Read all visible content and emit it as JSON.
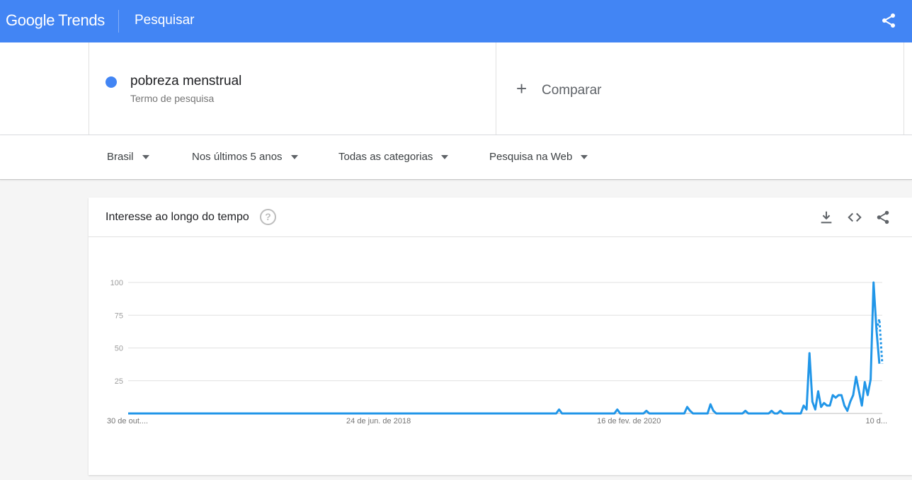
{
  "header": {
    "logo_google": "Google",
    "logo_trends": "Trends",
    "title": "Pesquisar",
    "share_icon": "share-icon"
  },
  "term": {
    "name": "pobreza menstrual",
    "subtitle": "Termo de pesquisa",
    "color": "#4285f4"
  },
  "compare": {
    "plus": "+",
    "label": "Comparar"
  },
  "filters": [
    {
      "label": "Brasil"
    },
    {
      "label": "Nos últimos 5 anos"
    },
    {
      "label": "Todas as categorias"
    },
    {
      "label": "Pesquisa na Web"
    }
  ],
  "card": {
    "title": "Interesse ao longo do tempo",
    "help": "?",
    "icons": [
      "download-icon",
      "embed-icon",
      "share-icon"
    ]
  },
  "chart_data": {
    "type": "line",
    "ylim": [
      0,
      100
    ],
    "yticks": [
      25,
      50,
      75,
      100
    ],
    "xtick_labels": [
      {
        "label": "30 de out....",
        "index": 0
      },
      {
        "label": "24 de jun. de 2018",
        "index": 86
      },
      {
        "label": "16 de fev. de 2020",
        "index": 172
      },
      {
        "label": "10 d...",
        "index": 257
      }
    ],
    "series_color": "#2196e8",
    "values": [
      0,
      0,
      0,
      0,
      0,
      0,
      0,
      0,
      0,
      0,
      0,
      0,
      0,
      0,
      0,
      0,
      0,
      0,
      0,
      0,
      0,
      0,
      0,
      0,
      0,
      0,
      0,
      0,
      0,
      0,
      0,
      0,
      0,
      0,
      0,
      0,
      0,
      0,
      0,
      0,
      0,
      0,
      0,
      0,
      0,
      0,
      0,
      0,
      0,
      0,
      0,
      0,
      0,
      0,
      0,
      0,
      0,
      0,
      0,
      0,
      0,
      0,
      0,
      0,
      0,
      0,
      0,
      0,
      0,
      0,
      0,
      0,
      0,
      0,
      0,
      0,
      0,
      0,
      0,
      0,
      0,
      0,
      0,
      0,
      0,
      0,
      0,
      0,
      0,
      0,
      0,
      0,
      0,
      0,
      0,
      0,
      0,
      0,
      0,
      0,
      0,
      0,
      0,
      0,
      0,
      0,
      0,
      0,
      0,
      0,
      0,
      0,
      0,
      0,
      0,
      0,
      0,
      0,
      0,
      0,
      0,
      0,
      0,
      0,
      0,
      0,
      0,
      0,
      0,
      0,
      0,
      0,
      0,
      0,
      0,
      0,
      0,
      0,
      0,
      0,
      0,
      0,
      0,
      0,
      0,
      0,
      0,
      0,
      3,
      0,
      0,
      0,
      0,
      0,
      0,
      0,
      0,
      0,
      0,
      0,
      0,
      0,
      0,
      0,
      0,
      0,
      0,
      0,
      3,
      0,
      0,
      0,
      0,
      0,
      0,
      0,
      0,
      0,
      2,
      0,
      0,
      0,
      0,
      0,
      0,
      0,
      0,
      0,
      0,
      0,
      0,
      0,
      5,
      2,
      0,
      0,
      0,
      0,
      0,
      0,
      7,
      2,
      0,
      0,
      0,
      0,
      0,
      0,
      0,
      0,
      0,
      0,
      2,
      0,
      0,
      0,
      0,
      0,
      0,
      0,
      0,
      2,
      0,
      0,
      2,
      0,
      0,
      0,
      0,
      0,
      0,
      0,
      6,
      3,
      46,
      9,
      3,
      17,
      5,
      8,
      6,
      6,
      14,
      12,
      14,
      14,
      6,
      2,
      9,
      14,
      28,
      17,
      6,
      24,
      14,
      26,
      100,
      64,
      38
    ],
    "partial_values": [
      72,
      38
    ]
  }
}
